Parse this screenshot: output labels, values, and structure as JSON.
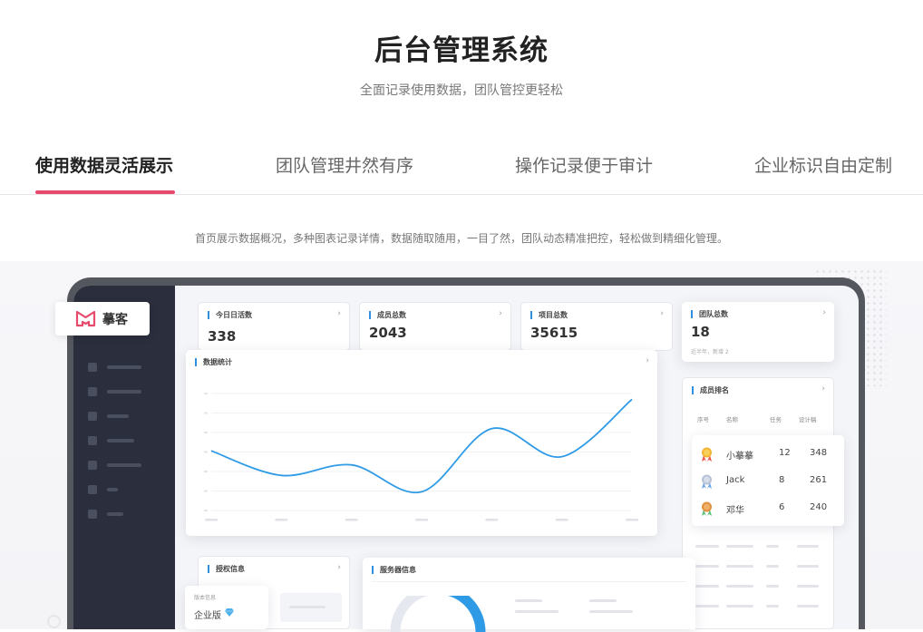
{
  "hero": {
    "title": "后台管理系统",
    "subtitle": "全面记录使用数据，团队管控更轻松"
  },
  "tabs": [
    {
      "label": "使用数据灵活展示",
      "active": true
    },
    {
      "label": "团队管理井然有序",
      "active": false
    },
    {
      "label": "操作记录便于审计",
      "active": false
    },
    {
      "label": "企业标识自由定制",
      "active": false
    }
  ],
  "description": "首页展示数据概况，多种图表记录详情，数据随取随用，一目了然，团队动态精准把控，轻松做到精细化管理。",
  "brand": {
    "name": "摹客",
    "color": "#e84a6d"
  },
  "accent": "#2f8fe0",
  "stats": [
    {
      "title": "今日日活数",
      "value": "338",
      "note": ""
    },
    {
      "title": "成员总数",
      "value": "2043",
      "note": ""
    },
    {
      "title": "项目总数",
      "value": "35615",
      "note": ""
    },
    {
      "title": "团队总数",
      "value": "18",
      "note": "近半年，新增 2"
    }
  ],
  "data_stats": {
    "title": "数据统计"
  },
  "ranking": {
    "title": "成员排名",
    "headers": [
      "序号",
      "名称",
      "任务",
      "设计稿"
    ],
    "rows": [
      {
        "medal": "gold-medal-icon",
        "name": "小摹摹",
        "tasks": "12",
        "designs": "348"
      },
      {
        "medal": "silver-medal-icon",
        "name": "Jack",
        "tasks": "8",
        "designs": "261"
      },
      {
        "medal": "bronze-medal-icon",
        "name": "邓华",
        "tasks": "6",
        "designs": "240"
      }
    ]
  },
  "license": {
    "title": "授权信息",
    "edition_label": "版本信息",
    "edition": "企业版"
  },
  "server": {
    "title": "服务器信息"
  },
  "chart_data": {
    "type": "line",
    "title": "数据统计",
    "xlabel": "",
    "ylabel": "",
    "x": [
      0,
      1,
      2,
      3,
      4,
      5,
      6
    ],
    "series": [
      {
        "values": [
          0.51,
          0.3,
          0.39,
          0.16,
          0.7,
          0.46,
          0.95
        ]
      }
    ],
    "ylim": [
      0,
      1
    ],
    "grid": true,
    "color": "#2f9be6"
  }
}
